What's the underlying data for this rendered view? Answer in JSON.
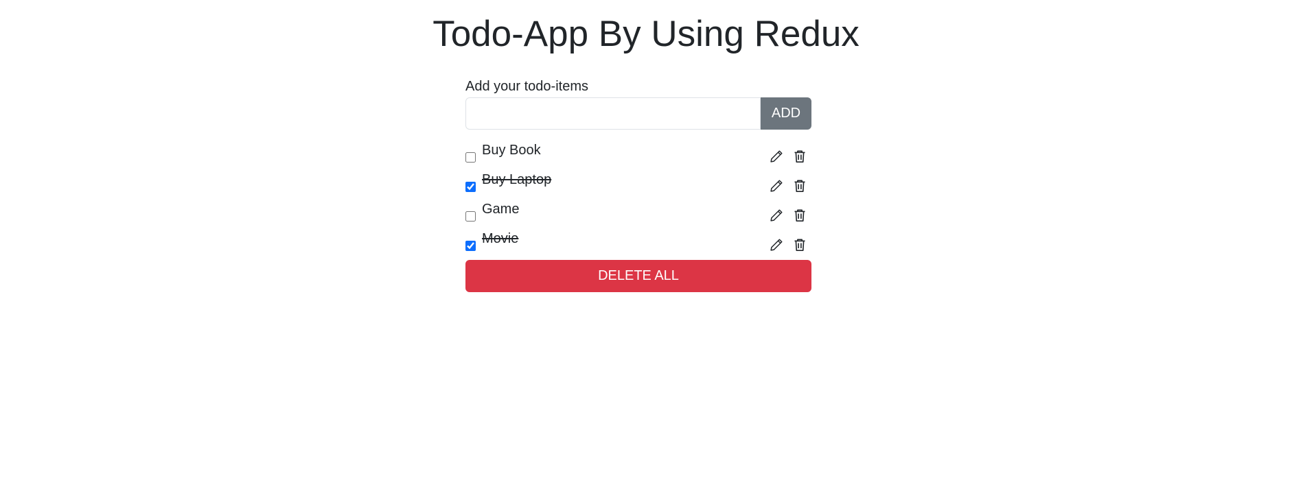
{
  "page": {
    "title": "Todo-App By Using Redux"
  },
  "form": {
    "label": "Add your todo-items",
    "input_value": "",
    "input_placeholder": "",
    "add_label": "ADD"
  },
  "todos": [
    {
      "text": "Buy Book",
      "completed": false
    },
    {
      "text": "Buy Laptop",
      "completed": true
    },
    {
      "text": "Game",
      "completed": false
    },
    {
      "text": "Movie",
      "completed": true
    }
  ],
  "icons": {
    "edit": "pencil-icon",
    "delete": "trash-icon"
  },
  "actions": {
    "delete_all_label": "DELETE ALL"
  },
  "colors": {
    "add_button": "#6c757d",
    "delete_all_button": "#dc3545",
    "checkbox_checked": "#0d6efd"
  }
}
